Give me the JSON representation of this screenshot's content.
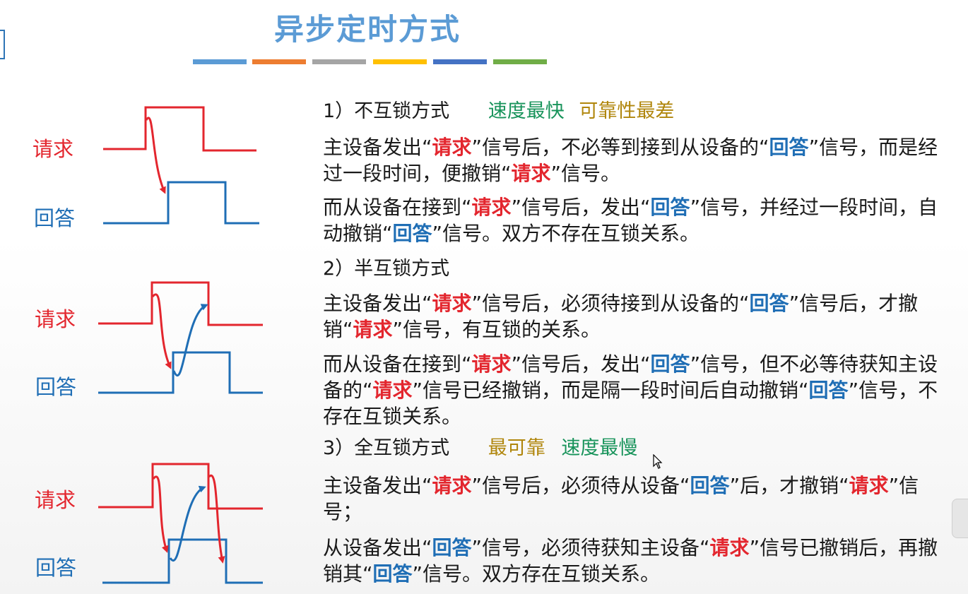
{
  "title": "异步定时方式",
  "stripe_colors": [
    "#5b9bd5",
    "#ed7d31",
    "#a5a5a5",
    "#ffc000",
    "#4472c4",
    "#70ad47"
  ],
  "signal_labels": {
    "request": "请求",
    "reply": "回答"
  },
  "sections": [
    {
      "heading": "1）不互锁方式",
      "tags": [
        {
          "text": "速度最快",
          "color": "green"
        },
        {
          "text": "可靠性最差",
          "color": "gold"
        }
      ],
      "paragraphs": [
        [
          "主设备发出“",
          {
            "r": "请求"
          },
          "”信号后，不必等到接到从设备的“",
          {
            "b": "回答"
          },
          "”信号，而是经过一段时间，便撤销“",
          {
            "r": "请求"
          },
          "”信号。"
        ],
        [
          "而从设备在接到“",
          {
            "r": "请求"
          },
          "”信号后，发出“",
          {
            "b": "回答"
          },
          "”信号，并经过一段时间，自动撤销“",
          {
            "b": "回答"
          },
          "”信号。双方不存在互锁关系。"
        ]
      ]
    },
    {
      "heading": "2）半互锁方式",
      "tags": [],
      "paragraphs": [
        [
          "主设备发出“",
          {
            "r": "请求"
          },
          "”信号后，必须待接到从设备的“",
          {
            "b": "回答"
          },
          "”信号后，才撤销“",
          {
            "r": "请求"
          },
          "”信号，有互锁的关系。"
        ],
        [
          "而从设备在接到“",
          {
            "r": "请求"
          },
          "”信号后，发出“",
          {
            "b": "回答"
          },
          "”信号，但不必等待获知主设备的“",
          {
            "r": "请求"
          },
          "”信号已经撤销，而是隔一段时间后自动撤销“",
          {
            "b": "回答"
          },
          "”信号，不存在互锁关系。"
        ]
      ]
    },
    {
      "heading": "3）全互锁方式",
      "tags": [
        {
          "text": "最可靠",
          "color": "gold"
        },
        {
          "text": "速度最慢",
          "color": "green"
        }
      ],
      "paragraphs": [
        [
          "主设备发出“",
          {
            "r": "请求"
          },
          "”信号后，必须待从设备“",
          {
            "b": "回答"
          },
          "”后，才撤销“",
          {
            "r": "请求"
          },
          "”信号；"
        ],
        [
          "从设备发出“",
          {
            "b": "回答"
          },
          "”信号，必须待获知主设备“",
          {
            "r": "请求"
          },
          "”信号已撤销后，再撤销其“",
          {
            "b": "回答"
          },
          "”信号。双方存在互锁关系。"
        ]
      ]
    }
  ]
}
